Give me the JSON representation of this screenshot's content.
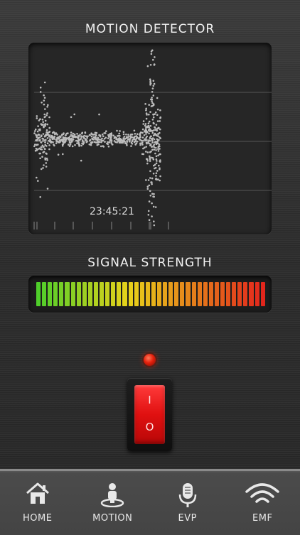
{
  "header": {
    "motion_title": "MOTION DETECTOR",
    "signal_title": "SIGNAL STRENGTH"
  },
  "scope": {
    "time": "23:45:21"
  },
  "signal": {
    "level": 1.0,
    "bar_count": 40,
    "colors": {
      "low": "#4fce2a",
      "mid": "#e8d21a",
      "high": "#e2261c"
    }
  },
  "switch": {
    "on_label": "I",
    "off_label": "O",
    "state": "on",
    "led_color": "#e5200c"
  },
  "tabs": [
    {
      "label": "HOME",
      "icon": "home-icon"
    },
    {
      "label": "MOTION",
      "icon": "motion-icon"
    },
    {
      "label": "EVP",
      "icon": "microphone-icon"
    },
    {
      "label": "EMF",
      "icon": "wifi-icon"
    }
  ]
}
